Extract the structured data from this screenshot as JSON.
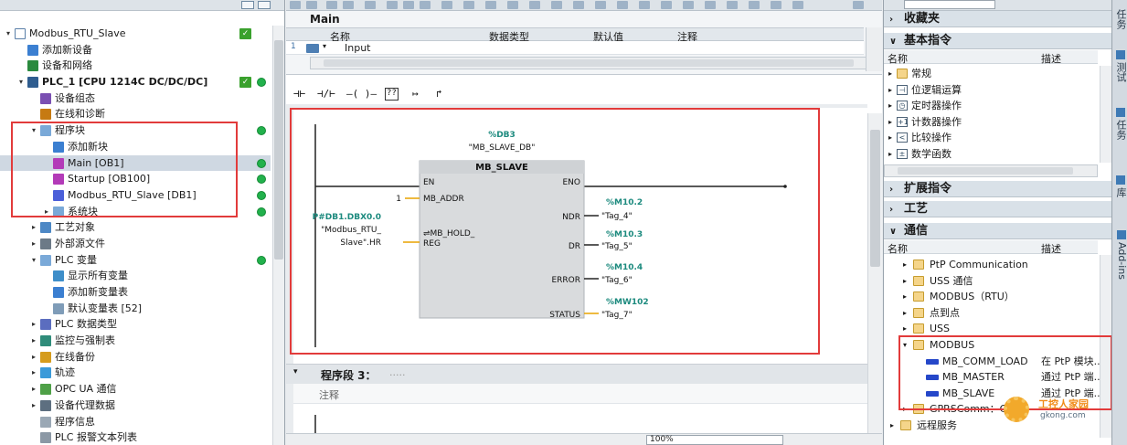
{
  "tree": {
    "items": [
      {
        "label": "Modbus_RTU_Slave",
        "indent": 0,
        "arrow": "▾",
        "icon": "document-icon",
        "iconClass": "i-doc",
        "check": true,
        "dot": false,
        "selected": false
      },
      {
        "label": "添加新设备",
        "indent": 1,
        "arrow": "",
        "icon": "add-device-icon",
        "iconClass": "i-add",
        "check": false,
        "dot": false,
        "selected": false
      },
      {
        "label": "设备和网络",
        "indent": 1,
        "arrow": "",
        "icon": "network-icon",
        "iconClass": "i-net",
        "check": false,
        "dot": false,
        "selected": false
      },
      {
        "label": "PLC_1 [CPU 1214C DC/DC/DC]",
        "indent": 1,
        "arrow": "▾",
        "icon": "plc-icon",
        "iconClass": "i-plc",
        "check": true,
        "dot": true,
        "selected": false,
        "bold": true
      },
      {
        "label": "设备组态",
        "indent": 2,
        "arrow": "",
        "icon": "device-config-icon",
        "iconClass": "i-cfg",
        "check": false,
        "dot": false,
        "selected": false
      },
      {
        "label": "在线和诊断",
        "indent": 2,
        "arrow": "",
        "icon": "diagnostics-icon",
        "iconClass": "i-diag",
        "check": false,
        "dot": false,
        "selected": false
      },
      {
        "label": "程序块",
        "indent": 2,
        "arrow": "▾",
        "icon": "folder-icon",
        "iconClass": "i-fold",
        "check": false,
        "dot": true,
        "selected": false
      },
      {
        "label": "添加新块",
        "indent": 3,
        "arrow": "",
        "icon": "add-block-icon",
        "iconClass": "i-add",
        "check": false,
        "dot": false,
        "selected": false
      },
      {
        "label": "Main [OB1]",
        "indent": 3,
        "arrow": "",
        "icon": "ob-block-icon",
        "iconClass": "i-ob",
        "check": false,
        "dot": true,
        "selected": true
      },
      {
        "label": "Startup [OB100]",
        "indent": 3,
        "arrow": "",
        "icon": "ob-block-icon",
        "iconClass": "i-ob",
        "check": false,
        "dot": true,
        "selected": false
      },
      {
        "label": "Modbus_RTU_Slave [DB1]",
        "indent": 3,
        "arrow": "",
        "icon": "db-block-icon",
        "iconClass": "i-db",
        "check": false,
        "dot": true,
        "selected": false
      },
      {
        "label": "系统块",
        "indent": 3,
        "arrow": "▸",
        "icon": "folder-icon",
        "iconClass": "i-fold",
        "check": false,
        "dot": true,
        "selected": false
      },
      {
        "label": "工艺对象",
        "indent": 2,
        "arrow": "▸",
        "icon": "technology-icon",
        "iconClass": "i-tech",
        "check": false,
        "dot": false,
        "selected": false
      },
      {
        "label": "外部源文件",
        "indent": 2,
        "arrow": "▸",
        "icon": "external-source-icon",
        "iconClass": "i-ext",
        "check": false,
        "dot": false,
        "selected": false
      },
      {
        "label": "PLC 变量",
        "indent": 2,
        "arrow": "▾",
        "icon": "folder-icon",
        "iconClass": "i-fold",
        "check": false,
        "dot": true,
        "selected": false
      },
      {
        "label": "显示所有变量",
        "indent": 3,
        "arrow": "",
        "icon": "tag-table-icon",
        "iconClass": "i-tag",
        "check": false,
        "dot": false,
        "selected": false
      },
      {
        "label": "添加新变量表",
        "indent": 3,
        "arrow": "",
        "icon": "add-table-icon",
        "iconClass": "i-add",
        "check": false,
        "dot": false,
        "selected": false
      },
      {
        "label": "默认变量表 [52]",
        "indent": 3,
        "arrow": "",
        "icon": "tag-table-icon",
        "iconClass": "i-list",
        "check": false,
        "dot": false,
        "selected": false
      },
      {
        "label": "PLC 数据类型",
        "indent": 2,
        "arrow": "▸",
        "icon": "data-type-icon",
        "iconClass": "i-type",
        "check": false,
        "dot": false,
        "selected": false
      },
      {
        "label": "监控与强制表",
        "indent": 2,
        "arrow": "▸",
        "icon": "watch-table-icon",
        "iconClass": "i-watch",
        "check": false,
        "dot": false,
        "selected": false
      },
      {
        "label": "在线备份",
        "indent": 2,
        "arrow": "▸",
        "icon": "backup-icon",
        "iconClass": "i-bak",
        "check": false,
        "dot": false,
        "selected": false
      },
      {
        "label": "轨迹",
        "indent": 2,
        "arrow": "▸",
        "icon": "trace-icon",
        "iconClass": "i-trace",
        "check": false,
        "dot": false,
        "selected": false
      },
      {
        "label": "OPC UA 通信",
        "indent": 2,
        "arrow": "▸",
        "icon": "opc-ua-icon",
        "iconClass": "i-opc",
        "check": false,
        "dot": false,
        "selected": false
      },
      {
        "label": "设备代理数据",
        "indent": 2,
        "arrow": "▸",
        "icon": "proxy-data-icon",
        "iconClass": "i-proxy",
        "check": false,
        "dot": false,
        "selected": false
      },
      {
        "label": "程序信息",
        "indent": 2,
        "arrow": "",
        "icon": "program-info-icon",
        "iconClass": "i-info",
        "check": false,
        "dot": false,
        "selected": false
      },
      {
        "label": "PLC 报警文本列表",
        "indent": 2,
        "arrow": "",
        "icon": "alarm-text-icon",
        "iconClass": "i-text",
        "check": false,
        "dot": false,
        "selected": false
      }
    ]
  },
  "editor": {
    "block_name": "Main",
    "columns": {
      "name": "名称",
      "type": "数据类型",
      "default": "默认值",
      "comment": "注释"
    },
    "row": {
      "index": "1",
      "name": "Input"
    },
    "ladder_toolbar": [
      "⊣⊢",
      "⊣/⊢",
      "–( )–",
      "??",
      "↦",
      "↱"
    ],
    "fb": {
      "db_addr": "%DB3",
      "db_name": "\"MB_SLAVE_DB\"",
      "title": "MB_SLAVE",
      "en": "EN",
      "eno": "ENO",
      "mb_addr_value": "1",
      "mb_addr": "MB_ADDR",
      "mb_hold": "⇌MB_HOLD_",
      "reg": "REG",
      "hold_addr": "P#DB1.DBX0.0",
      "hold_name1": "\"Modbus_RTU_",
      "hold_name2": "Slave\".HR",
      "ndr": "NDR",
      "dr": "DR",
      "error": "ERROR",
      "status": "STATUS",
      "out1_addr": "%M10.2",
      "out1_tag": "\"Tag_4\"",
      "out2_addr": "%M10.3",
      "out2_tag": "\"Tag_5\"",
      "out3_addr": "%M10.4",
      "out3_tag": "\"Tag_6\"",
      "out4_addr": "%MW102",
      "out4_tag": "\"Tag_7\""
    },
    "segment3": {
      "title": "程序段 3：",
      "dots": "....."
    },
    "comment_placeholder": "注释",
    "zoom": "100%"
  },
  "catalog": {
    "favorites": "收藏夹",
    "basic": "基本指令",
    "col_name": "名称",
    "col_desc": "描述",
    "basic_items": [
      {
        "label": "常规",
        "glyph": ""
      },
      {
        "label": "位逻辑运算",
        "glyph": "⊣"
      },
      {
        "label": "定时器操作",
        "glyph": "◷"
      },
      {
        "label": "计数器操作",
        "glyph": "+1"
      },
      {
        "label": "比较操作",
        "glyph": "<"
      },
      {
        "label": "数学函数",
        "glyph": "±"
      }
    ],
    "extended": "扩展指令",
    "tech": "工艺",
    "comm": "通信",
    "comm_items": [
      {
        "label": "PtP Communication",
        "type": "folder",
        "indent": 1,
        "arrow": "▸",
        "desc": ""
      },
      {
        "label": "USS 通信",
        "type": "folder",
        "indent": 1,
        "arrow": "▸",
        "desc": ""
      },
      {
        "label": "MODBUS（RTU）",
        "type": "folder",
        "indent": 1,
        "arrow": "▸",
        "desc": ""
      },
      {
        "label": "点到点",
        "type": "folder",
        "indent": 1,
        "arrow": "▸",
        "desc": ""
      },
      {
        "label": "USS",
        "type": "folder",
        "indent": 1,
        "arrow": "▸",
        "desc": ""
      },
      {
        "label": "MODBUS",
        "type": "folder",
        "indent": 1,
        "arrow": "▾",
        "desc": ""
      },
      {
        "label": "MB_COMM_LOAD",
        "type": "block",
        "indent": 2,
        "arrow": "",
        "desc": "在 PtP 模块..."
      },
      {
        "label": "MB_MASTER",
        "type": "block",
        "indent": 2,
        "arrow": "",
        "desc": "通过 PtP 端..."
      },
      {
        "label": "MB_SLAVE",
        "type": "block",
        "indent": 2,
        "arrow": "",
        "desc": "通过 PtP 端..."
      },
      {
        "label": "GPRSComm：CP...",
        "type": "folder",
        "indent": 1,
        "arrow": "▸",
        "desc": ""
      },
      {
        "label": "远程服务",
        "type": "folder",
        "indent": 0,
        "arrow": "▸",
        "desc": ""
      }
    ]
  },
  "vtabs": [
    "任务",
    "测试",
    "任务",
    "库",
    "Add-ins"
  ],
  "watermark": {
    "line1": "工控人家园",
    "line2": "gkong.com"
  }
}
